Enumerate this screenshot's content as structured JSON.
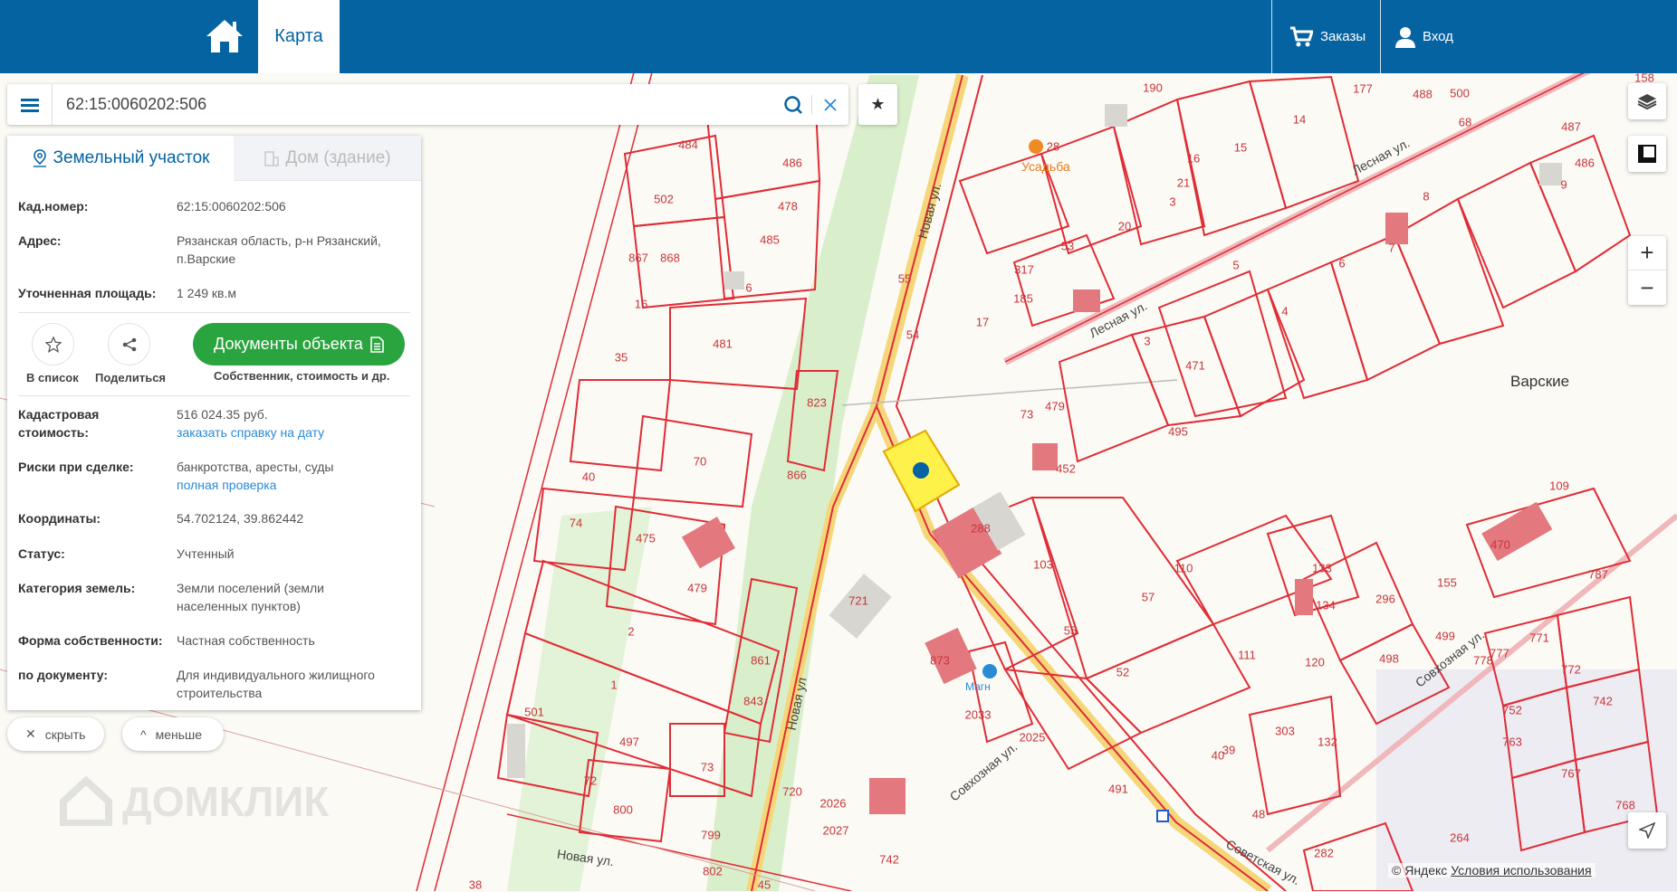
{
  "header": {
    "tab_map": "Карта",
    "orders": "Заказы",
    "login": "Вход"
  },
  "search": {
    "value": "62:15:0060202:506"
  },
  "panel": {
    "tab_land": "Земельный участок",
    "tab_house": "Дом (здание)",
    "rows": [
      {
        "label": "Кад.номер:",
        "value": "62:15:0060202:506"
      },
      {
        "label": "Адрес:",
        "value": "Рязанская область, р-н Рязанский, п.Варские"
      },
      {
        "label": "Уточненная площадь:",
        "value": "1 249 кв.м"
      },
      {
        "label": "Кадастровая стоимость:",
        "value": "516 024.35 руб.",
        "link": "заказать справку на дату"
      },
      {
        "label": "Риски при сделке:",
        "value": "банкротства, аресты, суды",
        "link": "полная проверка"
      },
      {
        "label": "Координаты:",
        "value": "54.702124, 39.862442"
      },
      {
        "label": "Статус:",
        "value": "Учтенный"
      },
      {
        "label": "Категория земель:",
        "value": "Земли поселений (земли населенных пунктов)"
      },
      {
        "label": "Форма собственности:",
        "value": "Частная собственность"
      },
      {
        "label": "по документу:",
        "value": "Для индивидуального жилищного строительства"
      }
    ],
    "add_to_list": "В список",
    "share": "Поделиться",
    "documents_button": "Документы объекта",
    "documents_sub": "Собственник, стоимость и др."
  },
  "pills": {
    "hide": "скрыть",
    "less": "меньше"
  },
  "map": {
    "place": "Варские",
    "poi": "Усадьба",
    "poi_shop": "Магн",
    "streets": [
      "Новая ул.",
      "Новая ул",
      "Новая ул.",
      "Лесная ул.",
      "Лесная ул.",
      "Совхозная ул.",
      "Совхозная ул.",
      "Советская ул."
    ],
    "parcels": [
      "484",
      "486",
      "502",
      "478",
      "485",
      "6",
      "481",
      "35",
      "16",
      "867",
      "868",
      "40",
      "70",
      "74",
      "475",
      "479",
      "2",
      "1",
      "501",
      "497",
      "73",
      "72",
      "800",
      "799",
      "802",
      "38",
      "45",
      "843",
      "861",
      "866",
      "823",
      "721",
      "720",
      "2026",
      "2027",
      "742",
      "55",
      "54",
      "17",
      "185",
      "317",
      "53",
      "20",
      "3",
      "21",
      "16",
      "15",
      "14",
      "177",
      "488",
      "500",
      "68",
      "158",
      "487",
      "486",
      "9",
      "8",
      "7",
      "6",
      "4",
      "5",
      "471",
      "3",
      "479",
      "73",
      "452",
      "495",
      "288",
      "103",
      "57",
      "55",
      "52",
      "109",
      "470",
      "787",
      "110",
      "133",
      "134",
      "296",
      "155",
      "499",
      "498",
      "111",
      "120",
      "303",
      "132",
      "40",
      "39",
      "48",
      "264",
      "282",
      "778",
      "771",
      "777",
      "772",
      "752",
      "742",
      "763",
      "767",
      "768",
      "873",
      "2033",
      "2025",
      "491",
      "190",
      "28"
    ],
    "watermark": "ДОМКЛИК",
    "attribution_copy": "© Яндекс",
    "attribution_terms": "Условия использования"
  },
  "colors": {
    "header": "#0563a1",
    "accent": "#2aa43e",
    "parcel": "#e02c36",
    "selected": "#ffeb3b"
  }
}
